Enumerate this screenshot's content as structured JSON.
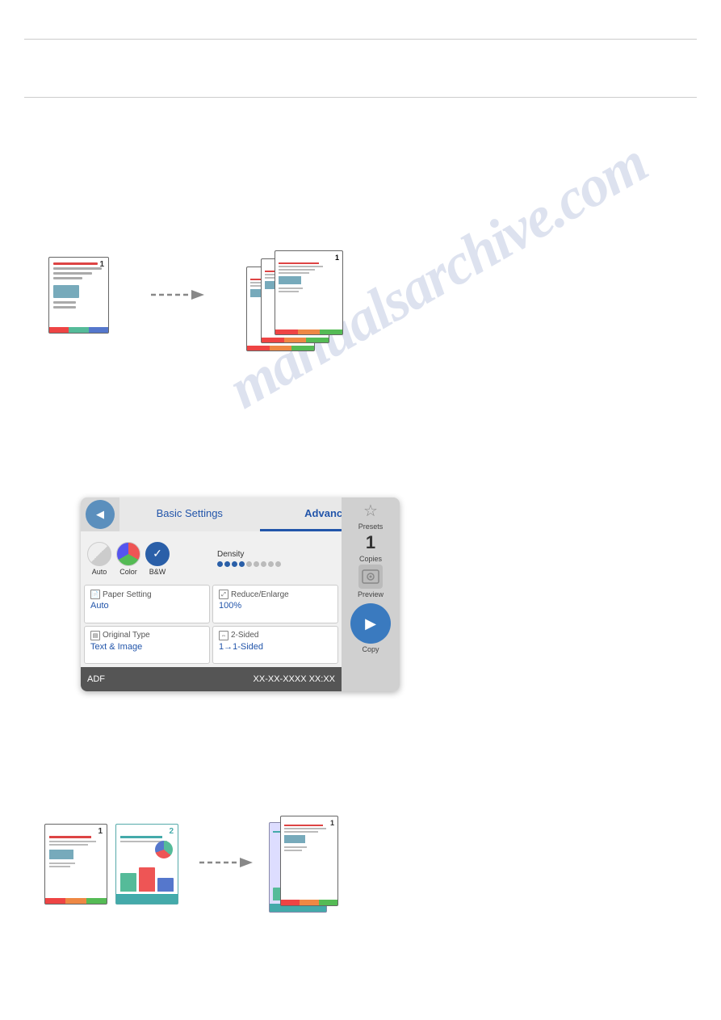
{
  "watermark": {
    "text": "manualsarchive.com"
  },
  "top_rule": {},
  "second_rule": {},
  "printer_ui": {
    "tab_basic": "Basic Settings",
    "tab_advanced": "Advanced",
    "color_options": [
      {
        "label": "Auto",
        "type": "auto"
      },
      {
        "label": "Color",
        "type": "color"
      },
      {
        "label": "B&W",
        "type": "bw",
        "selected": true
      }
    ],
    "density_label": "Density",
    "settings": [
      {
        "title": "Paper Setting",
        "value": "Auto"
      },
      {
        "title": "Reduce/Enlarge",
        "value": "100%"
      },
      {
        "title": "Original Type",
        "value": "Text & Image"
      },
      {
        "title": "2-Sided",
        "value": "1→1-Sided"
      }
    ],
    "status_left": "ADF",
    "status_right": "XX-XX-XXXX XX:XX",
    "right_panel": {
      "presets_label": "Presets",
      "copies_label": "Copies",
      "copies_value": "1",
      "preview_label": "Preview",
      "copy_label": "Copy"
    }
  }
}
